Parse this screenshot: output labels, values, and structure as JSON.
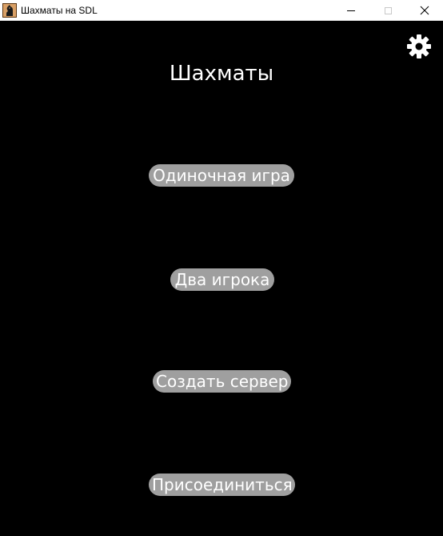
{
  "window": {
    "title": "Шахматы на SDL",
    "icon": "chess-knight-icon",
    "controls": {
      "minimize": "minimize-icon",
      "maximize": "maximize-icon",
      "close": "close-icon"
    }
  },
  "settings": {
    "icon": "gear-icon"
  },
  "main": {
    "title": "Шахматы",
    "buttons": {
      "single_player": "Одиночная игра",
      "two_players": "Два игрока",
      "create_server": "Создать сервер",
      "join": "Присоединиться"
    }
  },
  "colors": {
    "background": "#000000",
    "button_bg": "#9f9f9f",
    "text": "#ffffff"
  }
}
